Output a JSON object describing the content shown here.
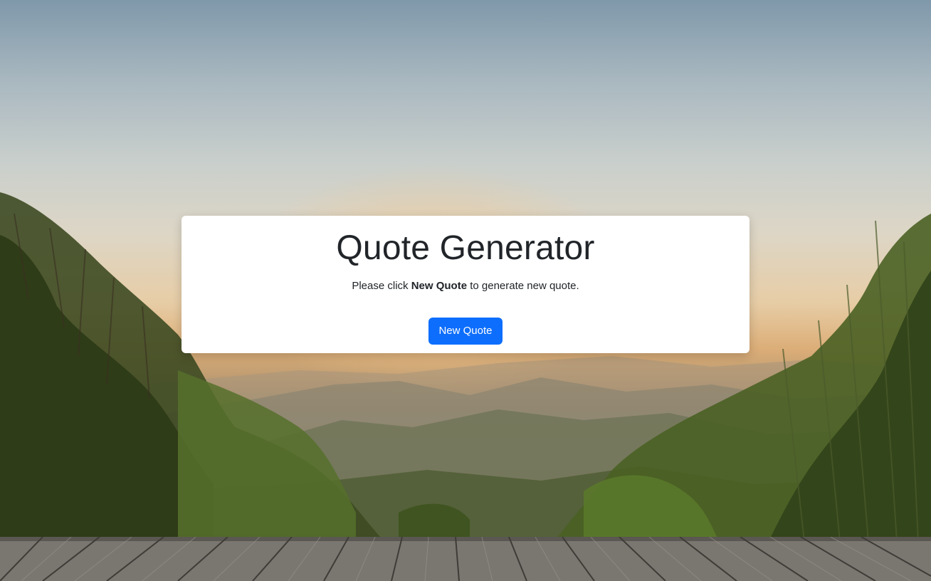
{
  "app": {
    "title": "Quote Generator",
    "instructions": {
      "prefix": "Please click ",
      "highlight": "New Quote",
      "suffix": " to generate new quote."
    },
    "button_label": "New Quote"
  },
  "colors": {
    "button_bg": "#0d6efd",
    "card_bg": "#ffffff",
    "text": "#212529"
  },
  "background": {
    "description_icon": "landscape-photo"
  }
}
